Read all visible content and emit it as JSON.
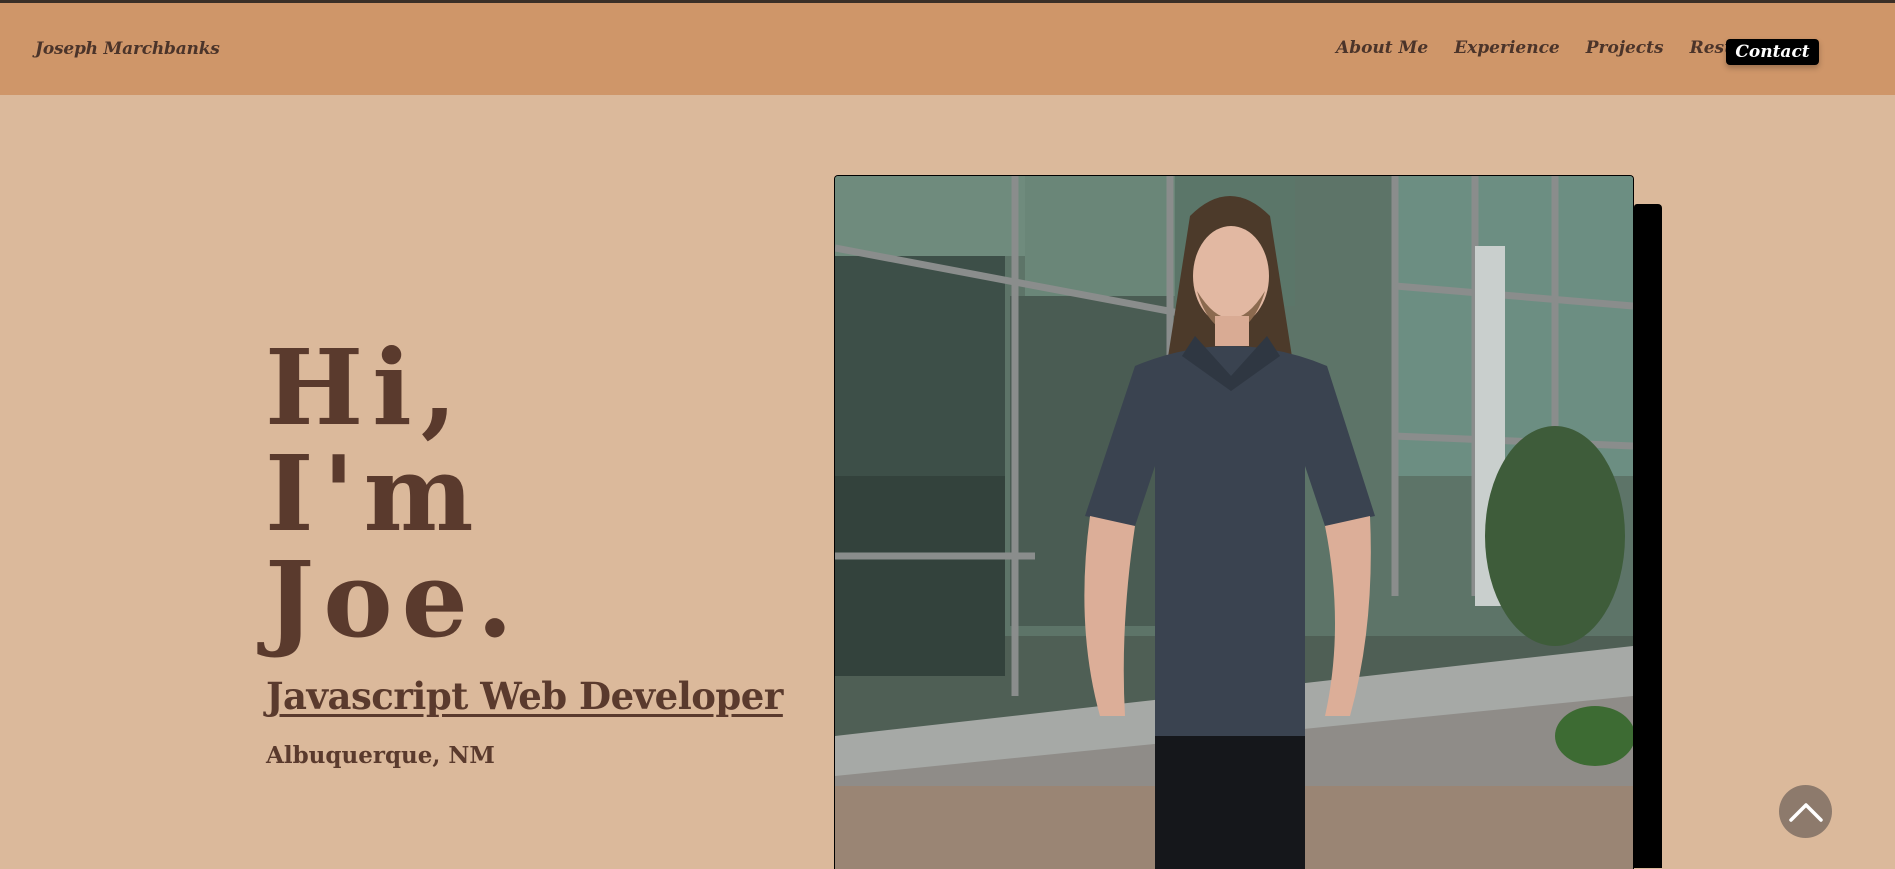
{
  "header": {
    "brand": "Joseph Marchbanks",
    "nav": [
      {
        "label": "About Me"
      },
      {
        "label": "Experience"
      },
      {
        "label": "Projects"
      },
      {
        "label": "Resume"
      }
    ],
    "contact_label": "Contact"
  },
  "hero": {
    "greeting_lines": [
      "Hi,",
      "I'm",
      "Joe."
    ],
    "role": "Javascript Web Developer",
    "location": "Albuquerque, NM"
  },
  "photo": {
    "subject": "portrait-photo"
  },
  "scroll_top": {
    "icon": "chevron-up-icon"
  },
  "colors": {
    "page_background": "#dbb99b",
    "navbar_background": "#cf9669",
    "text_dark_brown": "#5a3a2d",
    "contact_button": "#000000"
  }
}
